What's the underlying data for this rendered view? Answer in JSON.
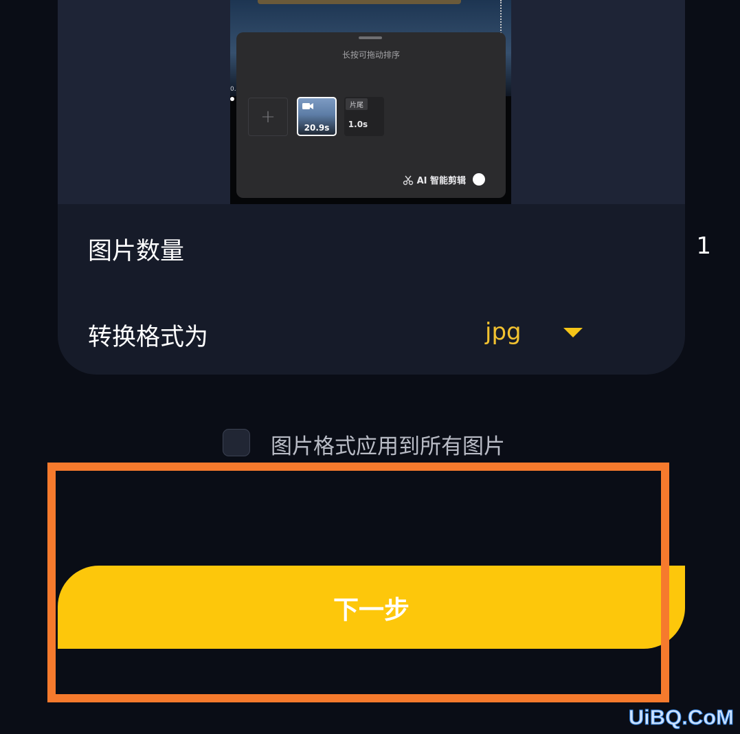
{
  "preview": {
    "left_marker": "0.",
    "sheet_hint": "长按可拖动排序",
    "add_label": "+",
    "clip_duration": "20.9s",
    "tail_badge": "片尾",
    "tail_duration": "1.0s",
    "ai_label": "AI 智能剪辑"
  },
  "settings": {
    "count_label": "图片数量",
    "count_value": "1",
    "format_label": "转换格式为",
    "format_value": "jpg"
  },
  "apply_all_label": "图片格式应用到所有图片",
  "next_button_label": "下一步",
  "watermark": "UiBQ.CoM",
  "colors": {
    "accent": "#fdc70b",
    "format_value": "#f2c230",
    "highlight": "#f67a2d",
    "background": "#0a0d16",
    "card": "#161b29"
  },
  "icons": [
    "camera-icon",
    "scissors-icon",
    "dropdown-caret-icon",
    "plus-icon"
  ]
}
